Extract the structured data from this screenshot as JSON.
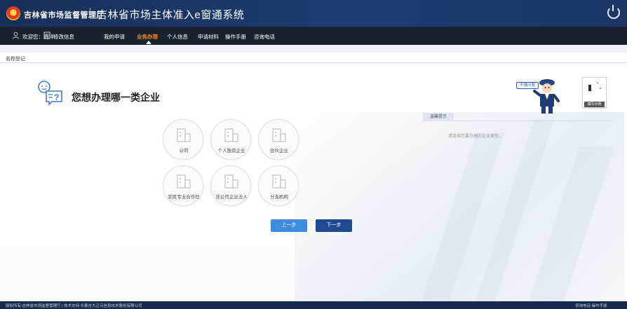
{
  "header": {
    "agency": "吉林省市场监督管理厅",
    "system_title": "吉林省市场主体准入e窗通系统"
  },
  "nav": {
    "welcome": "欢迎您：刘洋",
    "edit_info": "修改信息",
    "items": [
      "我的申请",
      "业务办理",
      "个人信息",
      "申请材料",
      "操作手册",
      "咨询电话"
    ],
    "active": "业务办理"
  },
  "breadcrumb": "名称登记",
  "prompt": {
    "title": "您想办理哪一类企业"
  },
  "enterprise_types": [
    {
      "label": "公司"
    },
    {
      "label": "个人独资企业"
    },
    {
      "label": "合伙企业"
    },
    {
      "label": "农民专业合作社"
    },
    {
      "label": "非公司企业法人"
    },
    {
      "label": "分支机构"
    }
  ],
  "buttons": {
    "prev": "上一步",
    "next": "下一步"
  },
  "tip": {
    "title": "温馨提示",
    "text": "请选择您要办理的企业类型。"
  },
  "helper": {
    "tag": "不懂问我",
    "guide_label": "填写示例"
  },
  "footer": {
    "left": "版权所有:吉林省市场监督管理厅 | 技术支持:长春吉大正元信息技术股份有限公司",
    "right": "咨询电话  操作手册"
  },
  "colors": {
    "header_bg": "#1c3c70",
    "nav_bg": "#1a2230",
    "nav_active": "#ff8a1e",
    "btn_prev": "#3d8ce0",
    "btn_next": "#1f4a92"
  },
  "icons": [
    "emblem-icon",
    "power-icon",
    "user-icon",
    "edit-icon",
    "question-icon",
    "building-icon",
    "mascot-icon"
  ]
}
